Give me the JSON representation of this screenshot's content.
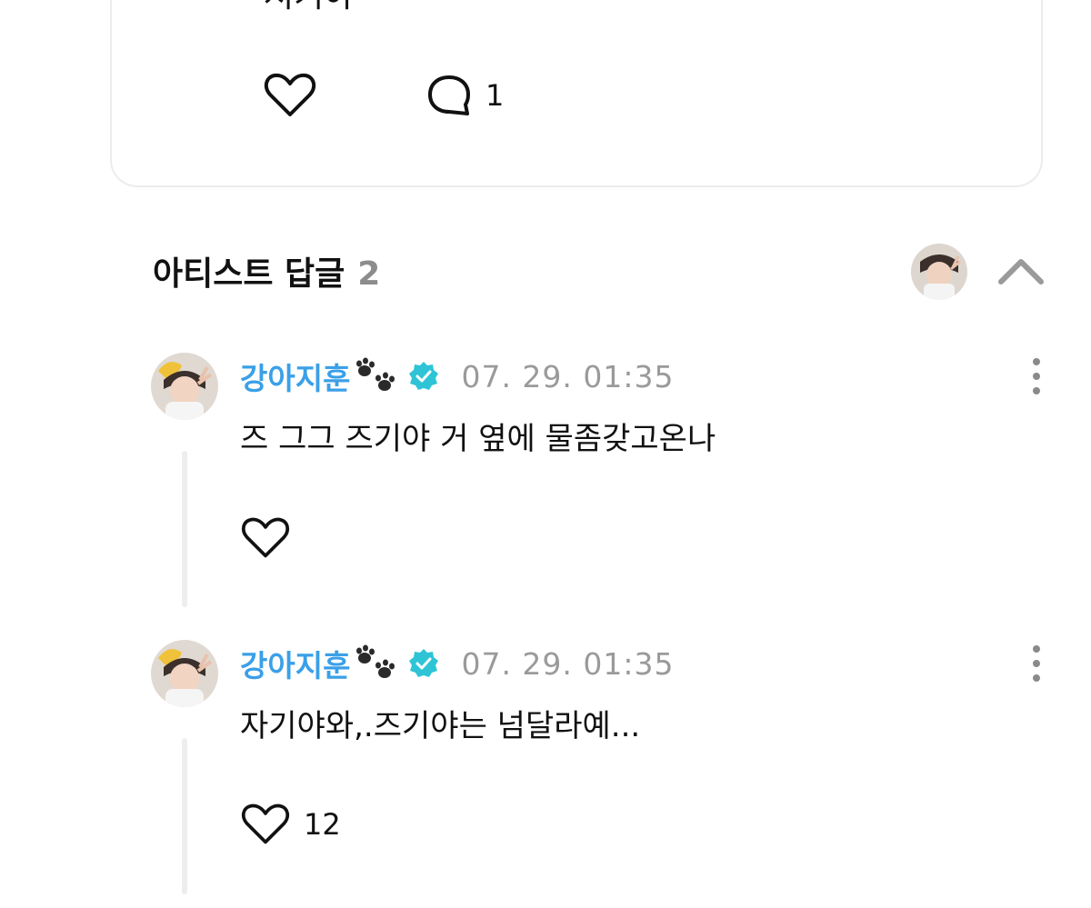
{
  "post": {
    "text": "저기야",
    "comment_count": "1",
    "icons": {
      "like": "heart-outline-icon",
      "comment": "speech-bubble-icon"
    }
  },
  "artist_replies": {
    "title": "아티스트 답글",
    "count": "2",
    "icons": {
      "collapse": "chevron-up-icon"
    }
  },
  "replies": [
    {
      "author": "강아지훈",
      "time": "07. 29. 01:35",
      "text": "즈 그그 즈기야 거 옆에 물좀갖고온나",
      "like_count": "",
      "icons": {
        "emoji": "paw-prints-icon",
        "badge": "verified-badge-icon",
        "menu": "more-vertical-icon"
      }
    },
    {
      "author": "강아지훈",
      "time": "07. 29. 01:35",
      "text": "자기야와,.즈기야는 넘달라예...",
      "like_count": "12",
      "icons": {
        "emoji": "paw-prints-icon",
        "badge": "verified-badge-icon",
        "menu": "more-vertical-icon"
      }
    }
  ],
  "colors": {
    "author_name": "#3aa0e8",
    "verified_badge": "#2ec4d6",
    "timestamp": "#9a9a9a",
    "reply_count": "#8c8c8c",
    "card_border": "#ececf0",
    "thread_line": "#eeeeee"
  }
}
